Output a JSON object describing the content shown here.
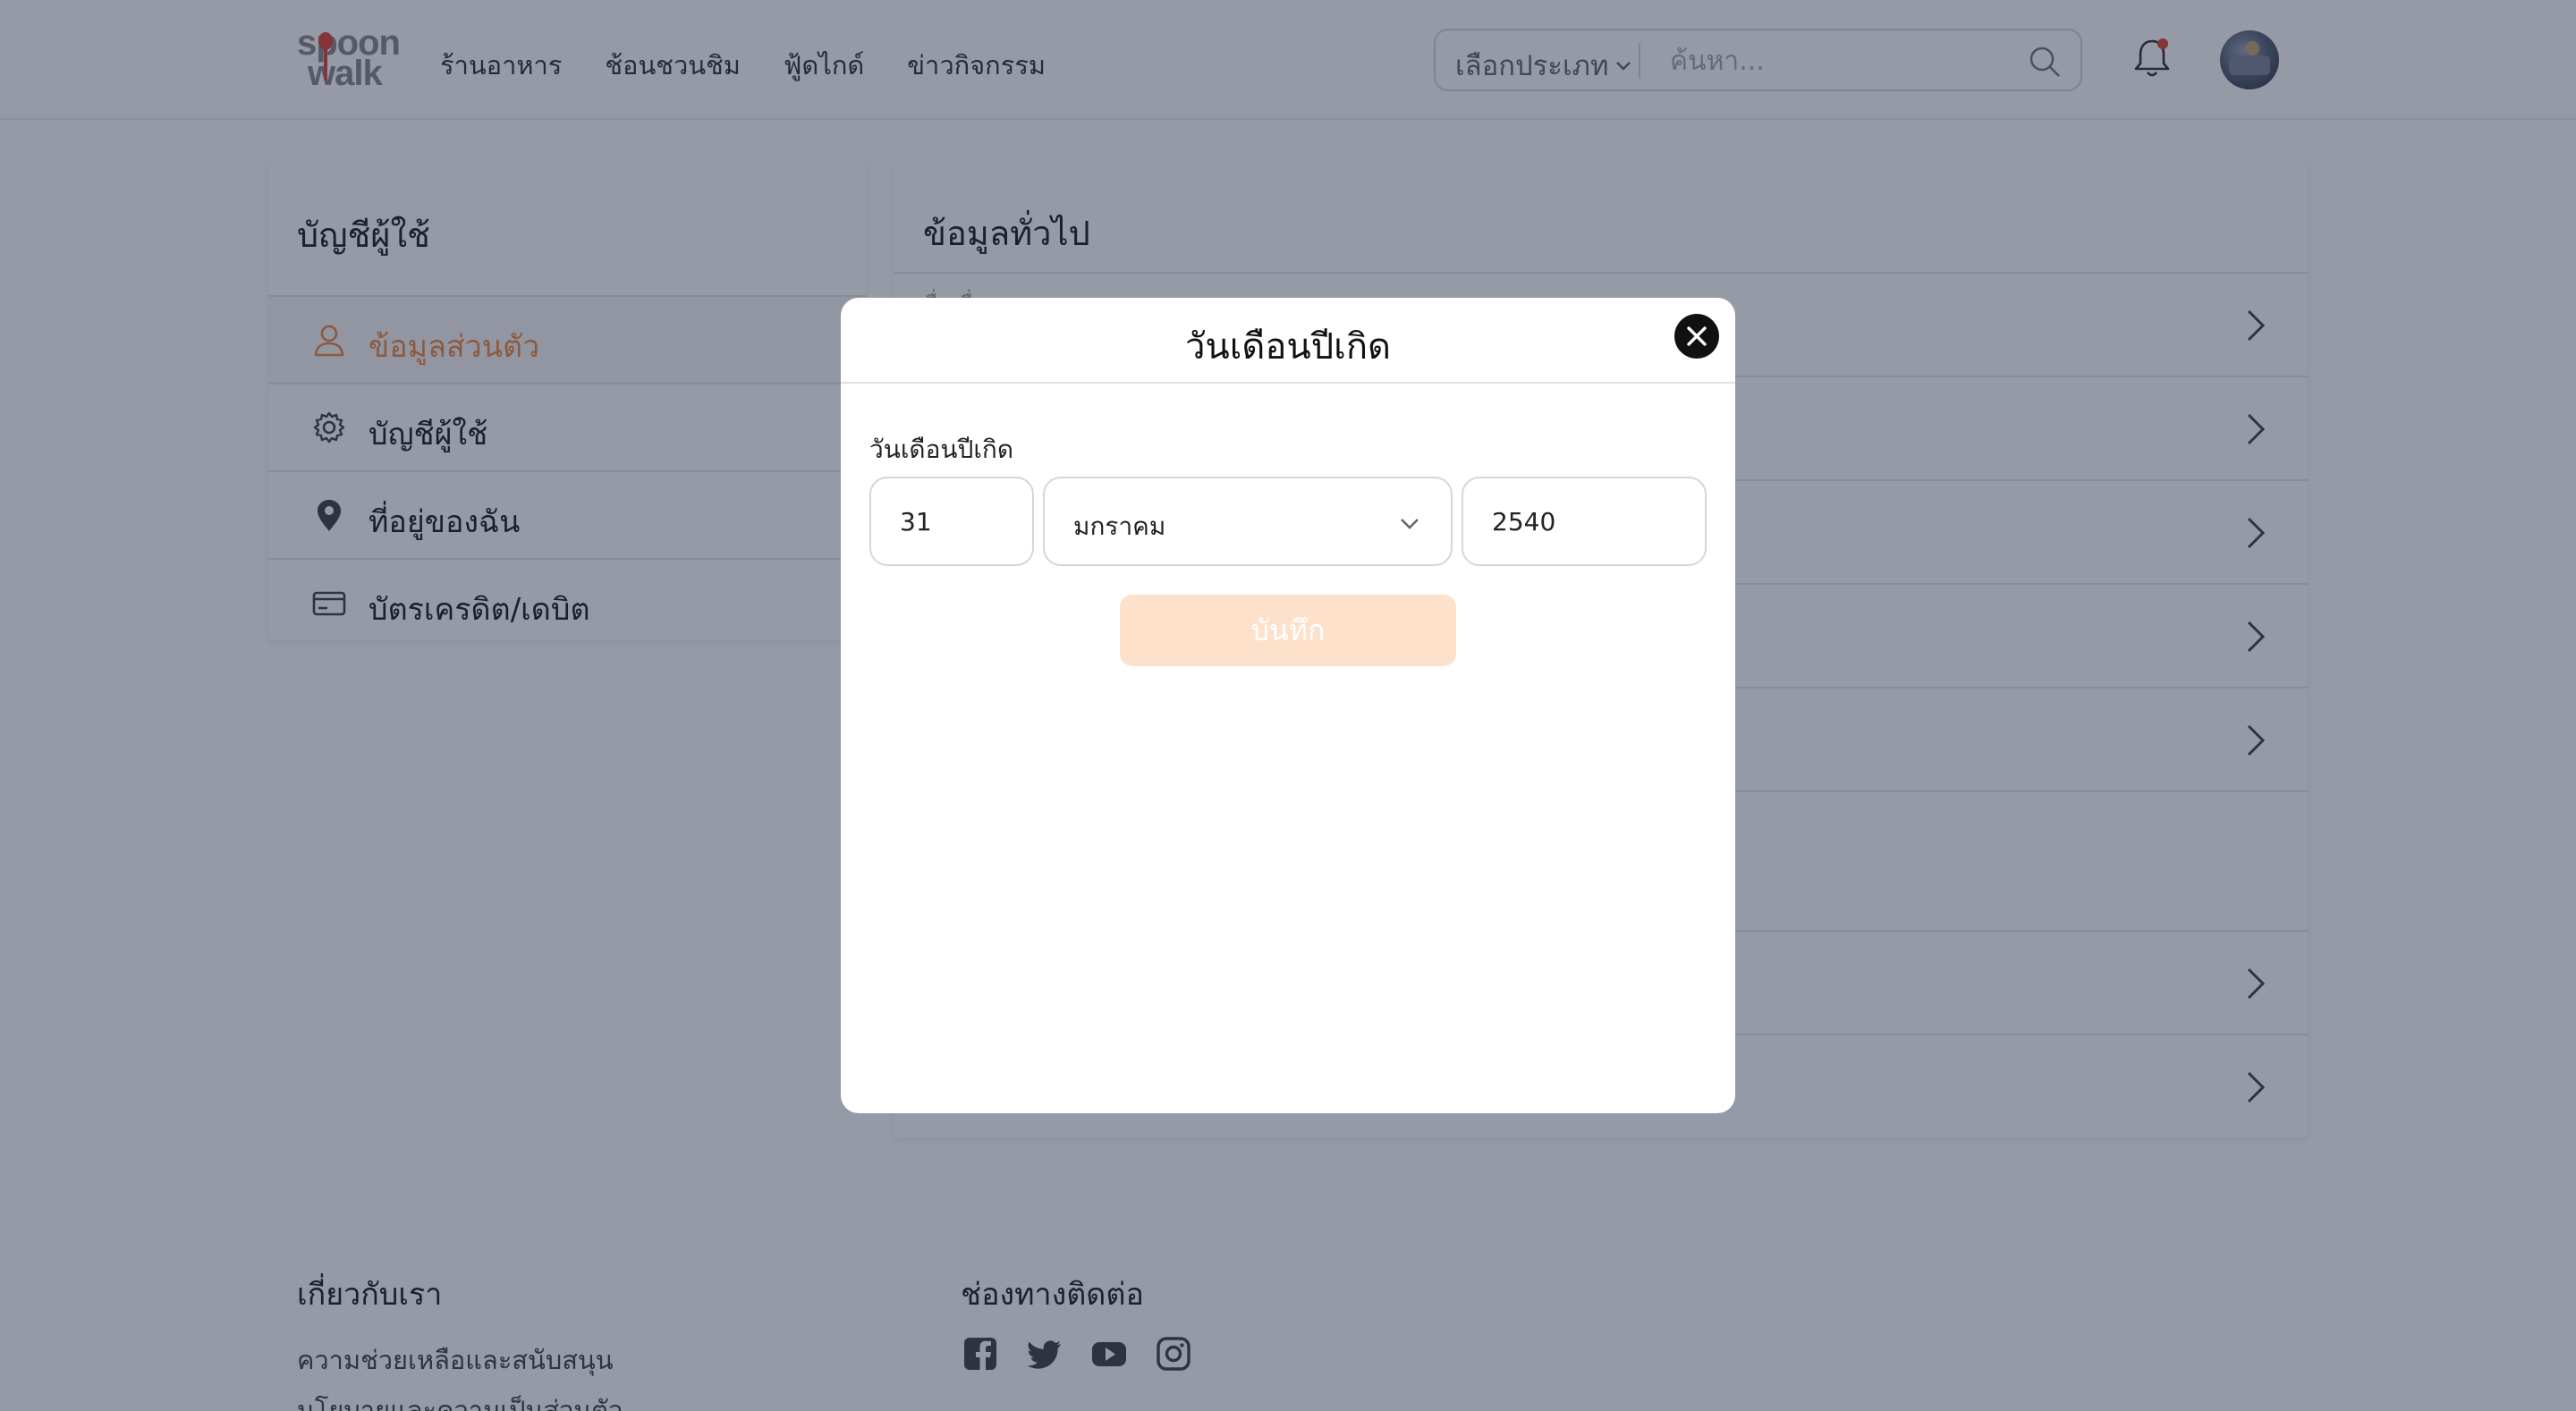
{
  "header": {
    "logo_top": "spoon",
    "logo_bottom": "walk",
    "nav": [
      "ร้านอาหาร",
      "ช้อนชวนชิม",
      "ฟู้ดไกด์",
      "ข่าวกิจกรรม"
    ],
    "search_category": "เลือกประเภท",
    "search_placeholder": "ค้นหา..."
  },
  "sidebar": {
    "title": "บัญชีผู้ใช้",
    "items": [
      {
        "label": "ข้อมูลส่วนตัว",
        "icon": "user-icon",
        "active": true
      },
      {
        "label": "บัญชีผู้ใช้",
        "icon": "gear-icon",
        "active": false
      },
      {
        "label": "ที่อยู่ของฉัน",
        "icon": "location-pin-icon",
        "active": false
      },
      {
        "label": "บัตรเครดิต/เดบิต",
        "icon": "credit-card-icon",
        "active": false
      }
    ]
  },
  "main": {
    "title": "ข้อมูลทั่วไป",
    "first_row_label": "ชื่อ-ชื่อรอง"
  },
  "footer": {
    "about_title": "เกี่ยวกับเรา",
    "about_links": [
      "ความช่วยเหลือและสนับสนุน",
      "นโยบายและความเป็นส่วนตัว"
    ],
    "contact_title": "ช่องทางติดต่อ",
    "social_icons": [
      "facebook-icon",
      "twitter-icon",
      "youtube-icon",
      "instagram-icon"
    ]
  },
  "modal": {
    "title": "วันเดือนปีเกิด",
    "field_label": "วันเดือนปีเกิด",
    "day": "31",
    "month": "มกราคม",
    "year": "2540",
    "save_label": "บันทึก"
  },
  "colors": {
    "accent": "#f08a43",
    "save_disabled": "#fde1cb",
    "overlay": "#16203a"
  }
}
